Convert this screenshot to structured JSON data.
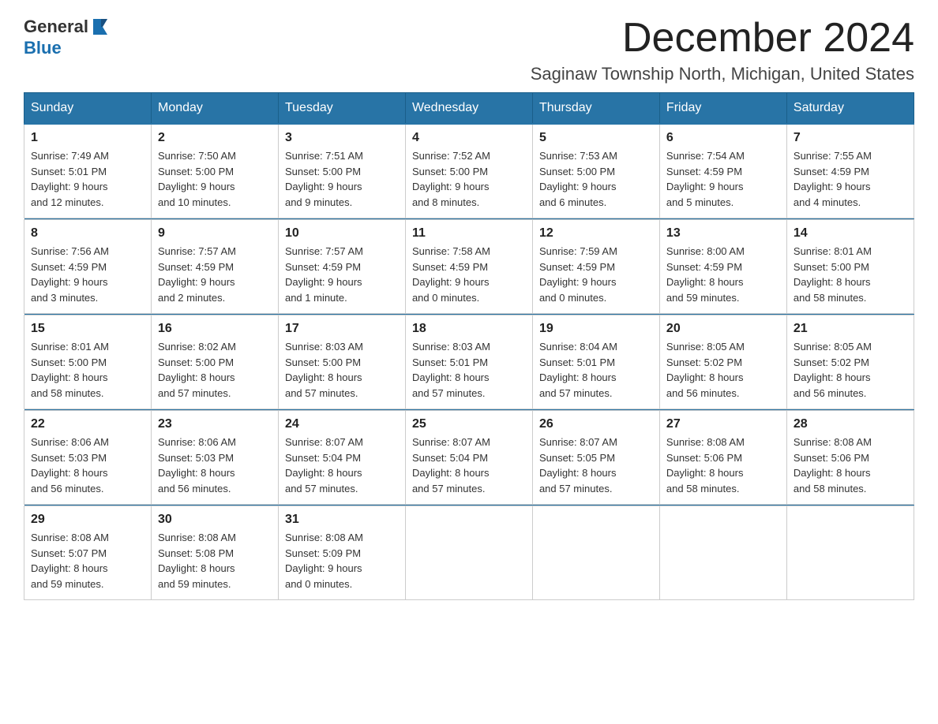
{
  "logo": {
    "text_general": "General",
    "text_blue": "Blue",
    "icon_alt": "GeneralBlue logo"
  },
  "title": {
    "month_year": "December 2024",
    "location": "Saginaw Township North, Michigan, United States"
  },
  "headers": [
    "Sunday",
    "Monday",
    "Tuesday",
    "Wednesday",
    "Thursday",
    "Friday",
    "Saturday"
  ],
  "weeks": [
    [
      {
        "day": "1",
        "info": "Sunrise: 7:49 AM\nSunset: 5:01 PM\nDaylight: 9 hours\nand 12 minutes."
      },
      {
        "day": "2",
        "info": "Sunrise: 7:50 AM\nSunset: 5:00 PM\nDaylight: 9 hours\nand 10 minutes."
      },
      {
        "day": "3",
        "info": "Sunrise: 7:51 AM\nSunset: 5:00 PM\nDaylight: 9 hours\nand 9 minutes."
      },
      {
        "day": "4",
        "info": "Sunrise: 7:52 AM\nSunset: 5:00 PM\nDaylight: 9 hours\nand 8 minutes."
      },
      {
        "day": "5",
        "info": "Sunrise: 7:53 AM\nSunset: 5:00 PM\nDaylight: 9 hours\nand 6 minutes."
      },
      {
        "day": "6",
        "info": "Sunrise: 7:54 AM\nSunset: 4:59 PM\nDaylight: 9 hours\nand 5 minutes."
      },
      {
        "day": "7",
        "info": "Sunrise: 7:55 AM\nSunset: 4:59 PM\nDaylight: 9 hours\nand 4 minutes."
      }
    ],
    [
      {
        "day": "8",
        "info": "Sunrise: 7:56 AM\nSunset: 4:59 PM\nDaylight: 9 hours\nand 3 minutes."
      },
      {
        "day": "9",
        "info": "Sunrise: 7:57 AM\nSunset: 4:59 PM\nDaylight: 9 hours\nand 2 minutes."
      },
      {
        "day": "10",
        "info": "Sunrise: 7:57 AM\nSunset: 4:59 PM\nDaylight: 9 hours\nand 1 minute."
      },
      {
        "day": "11",
        "info": "Sunrise: 7:58 AM\nSunset: 4:59 PM\nDaylight: 9 hours\nand 0 minutes."
      },
      {
        "day": "12",
        "info": "Sunrise: 7:59 AM\nSunset: 4:59 PM\nDaylight: 9 hours\nand 0 minutes."
      },
      {
        "day": "13",
        "info": "Sunrise: 8:00 AM\nSunset: 4:59 PM\nDaylight: 8 hours\nand 59 minutes."
      },
      {
        "day": "14",
        "info": "Sunrise: 8:01 AM\nSunset: 5:00 PM\nDaylight: 8 hours\nand 58 minutes."
      }
    ],
    [
      {
        "day": "15",
        "info": "Sunrise: 8:01 AM\nSunset: 5:00 PM\nDaylight: 8 hours\nand 58 minutes."
      },
      {
        "day": "16",
        "info": "Sunrise: 8:02 AM\nSunset: 5:00 PM\nDaylight: 8 hours\nand 57 minutes."
      },
      {
        "day": "17",
        "info": "Sunrise: 8:03 AM\nSunset: 5:00 PM\nDaylight: 8 hours\nand 57 minutes."
      },
      {
        "day": "18",
        "info": "Sunrise: 8:03 AM\nSunset: 5:01 PM\nDaylight: 8 hours\nand 57 minutes."
      },
      {
        "day": "19",
        "info": "Sunrise: 8:04 AM\nSunset: 5:01 PM\nDaylight: 8 hours\nand 57 minutes."
      },
      {
        "day": "20",
        "info": "Sunrise: 8:05 AM\nSunset: 5:02 PM\nDaylight: 8 hours\nand 56 minutes."
      },
      {
        "day": "21",
        "info": "Sunrise: 8:05 AM\nSunset: 5:02 PM\nDaylight: 8 hours\nand 56 minutes."
      }
    ],
    [
      {
        "day": "22",
        "info": "Sunrise: 8:06 AM\nSunset: 5:03 PM\nDaylight: 8 hours\nand 56 minutes."
      },
      {
        "day": "23",
        "info": "Sunrise: 8:06 AM\nSunset: 5:03 PM\nDaylight: 8 hours\nand 56 minutes."
      },
      {
        "day": "24",
        "info": "Sunrise: 8:07 AM\nSunset: 5:04 PM\nDaylight: 8 hours\nand 57 minutes."
      },
      {
        "day": "25",
        "info": "Sunrise: 8:07 AM\nSunset: 5:04 PM\nDaylight: 8 hours\nand 57 minutes."
      },
      {
        "day": "26",
        "info": "Sunrise: 8:07 AM\nSunset: 5:05 PM\nDaylight: 8 hours\nand 57 minutes."
      },
      {
        "day": "27",
        "info": "Sunrise: 8:08 AM\nSunset: 5:06 PM\nDaylight: 8 hours\nand 58 minutes."
      },
      {
        "day": "28",
        "info": "Sunrise: 8:08 AM\nSunset: 5:06 PM\nDaylight: 8 hours\nand 58 minutes."
      }
    ],
    [
      {
        "day": "29",
        "info": "Sunrise: 8:08 AM\nSunset: 5:07 PM\nDaylight: 8 hours\nand 59 minutes."
      },
      {
        "day": "30",
        "info": "Sunrise: 8:08 AM\nSunset: 5:08 PM\nDaylight: 8 hours\nand 59 minutes."
      },
      {
        "day": "31",
        "info": "Sunrise: 8:08 AM\nSunset: 5:09 PM\nDaylight: 9 hours\nand 0 minutes."
      },
      {
        "day": "",
        "info": ""
      },
      {
        "day": "",
        "info": ""
      },
      {
        "day": "",
        "info": ""
      },
      {
        "day": "",
        "info": ""
      }
    ]
  ]
}
